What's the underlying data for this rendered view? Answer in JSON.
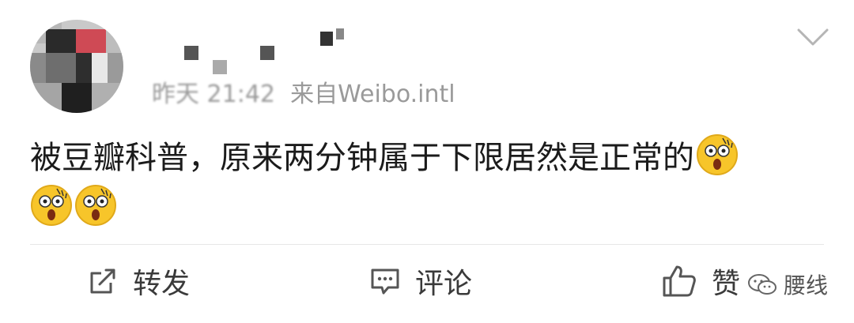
{
  "post": {
    "author_name_obscured": true,
    "timestamp": "昨天 21:42",
    "source": "来自Weibo.intl",
    "text": "被豆瓣科普，原来两分钟属于下限居然是正常的",
    "emoji_count": 3,
    "emoji_icon": "shocked-face-icon"
  },
  "actions": {
    "repost_label": "转发",
    "comment_label": "评论",
    "like_label": "赞"
  },
  "watermark": {
    "label": "腰线",
    "icon": "wechat-icon"
  },
  "colors": {
    "meta_text": "#9a9a9a",
    "body_text": "#1b1b1b",
    "divider": "#e7e7e7",
    "emoji_fill": "#f7c52a"
  }
}
